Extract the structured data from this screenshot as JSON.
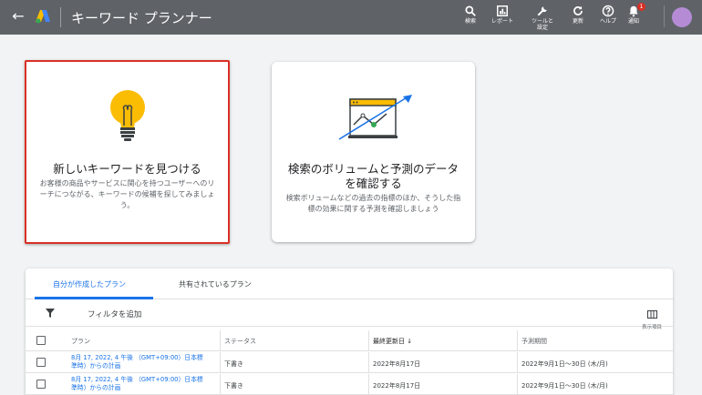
{
  "topbar": {
    "title": "キーワード プランナー",
    "buttons": [
      {
        "icon": "search-icon",
        "label": "検索"
      },
      {
        "icon": "report-icon",
        "label": "レポート"
      },
      {
        "icon": "tools-icon",
        "label": "ツールと\n設定"
      },
      {
        "icon": "refresh-icon",
        "label": "更新"
      },
      {
        "icon": "help-icon",
        "label": "ヘルプ"
      },
      {
        "icon": "bell-icon",
        "label": "通知"
      }
    ],
    "notification_count": "1"
  },
  "cards": {
    "discover": {
      "title": "新しいキーワードを見つける",
      "desc": "お客様の商品やサービスに関心を持つユーザーへのリーチにつながる、キーワードの候補を探してみましょう。"
    },
    "forecast": {
      "title": "検索のボリュームと予測のデータを確認する",
      "desc": "検索ボリュームなどの過去の指標のほか、そうした指標の効果に関する予測を確認しましょう"
    }
  },
  "plans": {
    "tabs": [
      "自分が作成したプラン",
      "共有されているプラン"
    ],
    "filter_label": "フィルタを追加",
    "columns_label": "表示項目",
    "headers": {
      "plan": "プラン",
      "status": "ステータス",
      "updated": "最終更新日",
      "period": "予測期間"
    },
    "rows": [
      {
        "plan": "8月 17, 2022, 4 午後 （GMT+09:00）日本標準時）からの計画",
        "status": "下書き",
        "updated": "2022年8月17日",
        "period": "2022年9月1日～30日 (木/月)"
      },
      {
        "plan": "8月 17, 2022, 4 午後 （GMT+09:00）日本標準時）からの計画",
        "status": "下書き",
        "updated": "2022年8月17日",
        "period": "2022年9月1日～30日 (木/月)"
      }
    ]
  },
  "colors": {
    "accent": "#1a73e8",
    "topbar": "#5f6368",
    "highlight": "#d93025",
    "bulb": "#fbbc04"
  }
}
